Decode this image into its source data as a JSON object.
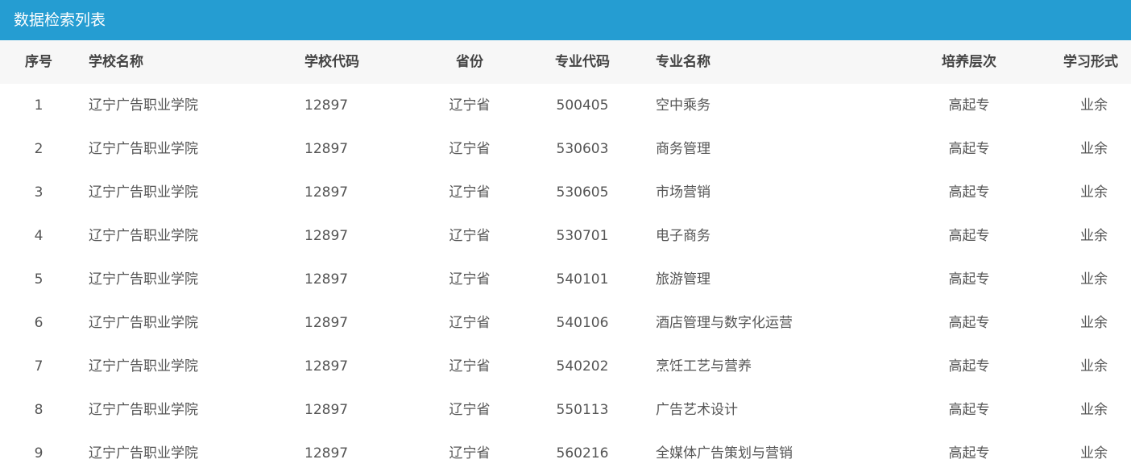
{
  "panel": {
    "title": "数据检索列表"
  },
  "table": {
    "columns": [
      "序号",
      "学校名称",
      "学校代码",
      "省份",
      "专业代码",
      "专业名称",
      "培养层次",
      "学习形式"
    ],
    "rows": [
      [
        "1",
        "辽宁广告职业学院",
        "12897",
        "辽宁省",
        "500405",
        "空中乘务",
        "高起专",
        "业余"
      ],
      [
        "2",
        "辽宁广告职业学院",
        "12897",
        "辽宁省",
        "530603",
        "商务管理",
        "高起专",
        "业余"
      ],
      [
        "3",
        "辽宁广告职业学院",
        "12897",
        "辽宁省",
        "530605",
        "市场营销",
        "高起专",
        "业余"
      ],
      [
        "4",
        "辽宁广告职业学院",
        "12897",
        "辽宁省",
        "530701",
        "电子商务",
        "高起专",
        "业余"
      ],
      [
        "5",
        "辽宁广告职业学院",
        "12897",
        "辽宁省",
        "540101",
        "旅游管理",
        "高起专",
        "业余"
      ],
      [
        "6",
        "辽宁广告职业学院",
        "12897",
        "辽宁省",
        "540106",
        "酒店管理与数字化运营",
        "高起专",
        "业余"
      ],
      [
        "7",
        "辽宁广告职业学院",
        "12897",
        "辽宁省",
        "540202",
        "烹饪工艺与营养",
        "高起专",
        "业余"
      ],
      [
        "8",
        "辽宁广告职业学院",
        "12897",
        "辽宁省",
        "550113",
        "广告艺术设计",
        "高起专",
        "业余"
      ],
      [
        "9",
        "辽宁广告职业学院",
        "12897",
        "辽宁省",
        "560216",
        "全媒体广告策划与营销",
        "高起专",
        "业余"
      ]
    ]
  },
  "colors": {
    "header_bg": "#259dd2",
    "header_text": "#ffffff",
    "table_head_bg": "#f7f7f7",
    "body_text": "#555555"
  }
}
